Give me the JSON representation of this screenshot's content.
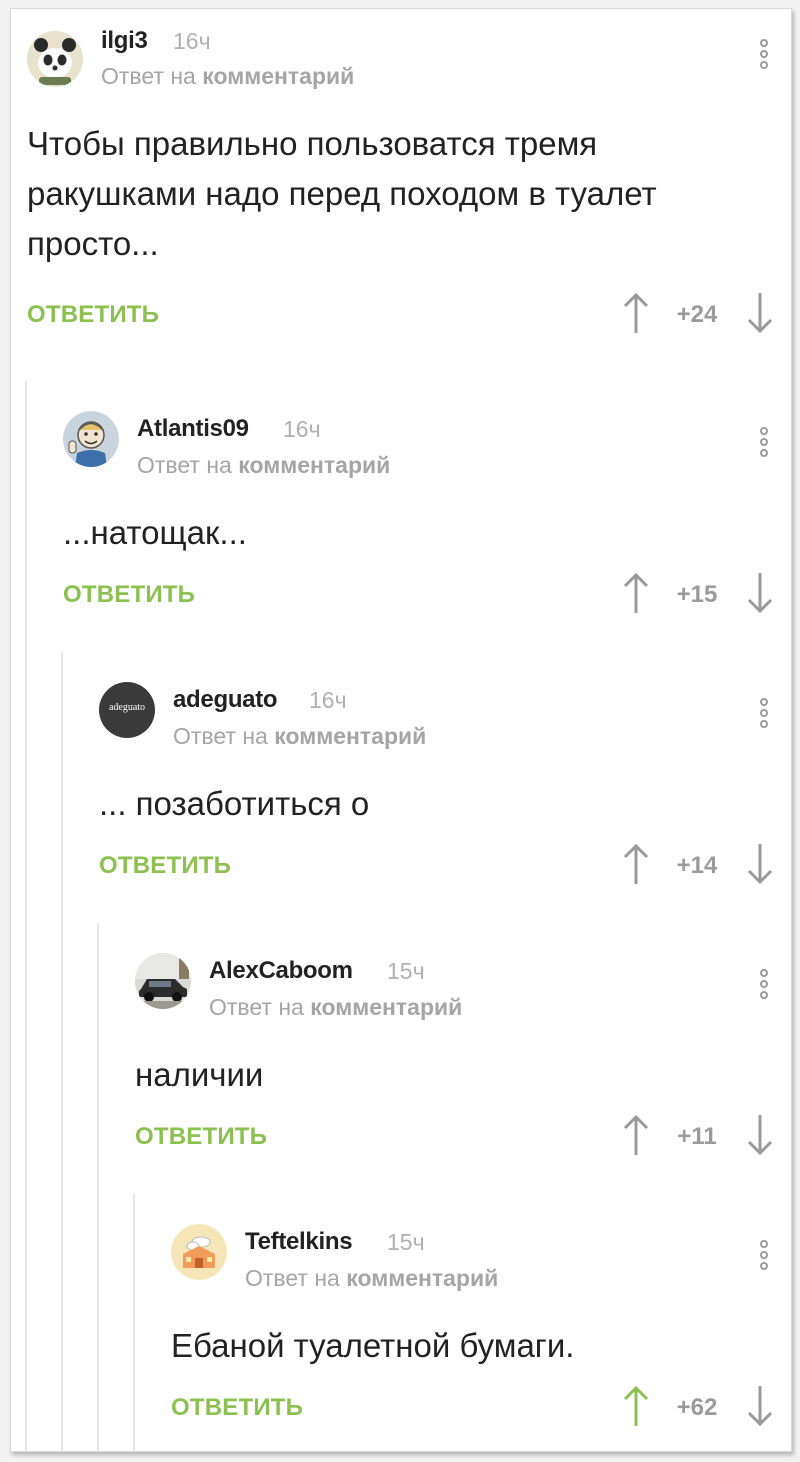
{
  "comments": [
    {
      "username": "ilgi3",
      "time": "16ч",
      "reply_prefix": "Ответ на",
      "reply_target": "комментарий",
      "text": "Чтобы правильно пользоватся тремя ракушками надо перед походом в туалет просто...",
      "reply_label": "ОТВЕТИТЬ",
      "score": "+24",
      "avatar_icon": "panda-avatar-icon"
    },
    {
      "username": "Atlantis09",
      "time": "16ч",
      "reply_prefix": "Ответ на",
      "reply_target": "комментарий",
      "text": "...натощак...",
      "reply_label": "ОТВЕТИТЬ",
      "score": "+15",
      "avatar_icon": "vault-boy-avatar-icon"
    },
    {
      "username": "adeguato",
      "time": "16ч",
      "reply_prefix": "Ответ на",
      "reply_target": "комментарий",
      "text": "... позаботиться о",
      "reply_label": "ОТВЕТИТЬ",
      "score": "+14",
      "avatar_text": "adeguato"
    },
    {
      "username": "AlexCaboom",
      "time": "15ч",
      "reply_prefix": "Ответ на",
      "reply_target": "комментарий",
      "text": "наличии",
      "reply_label": "ОТВЕТИТЬ",
      "score": "+11",
      "avatar_icon": "car-avatar-icon"
    },
    {
      "username": "Teftelkins",
      "time": "15ч",
      "reply_prefix": "Ответ на",
      "reply_target": "комментарий",
      "text": "Ебаной туалетной бумаги.",
      "reply_label": "ОТВЕТИТЬ",
      "score": "+62",
      "avatar_icon": "cartoon-house-avatar-icon",
      "upvoted": true
    }
  ],
  "colors": {
    "accent_green": "#8cc152",
    "muted_gray": "#9a9a9a",
    "text": "#222222"
  }
}
